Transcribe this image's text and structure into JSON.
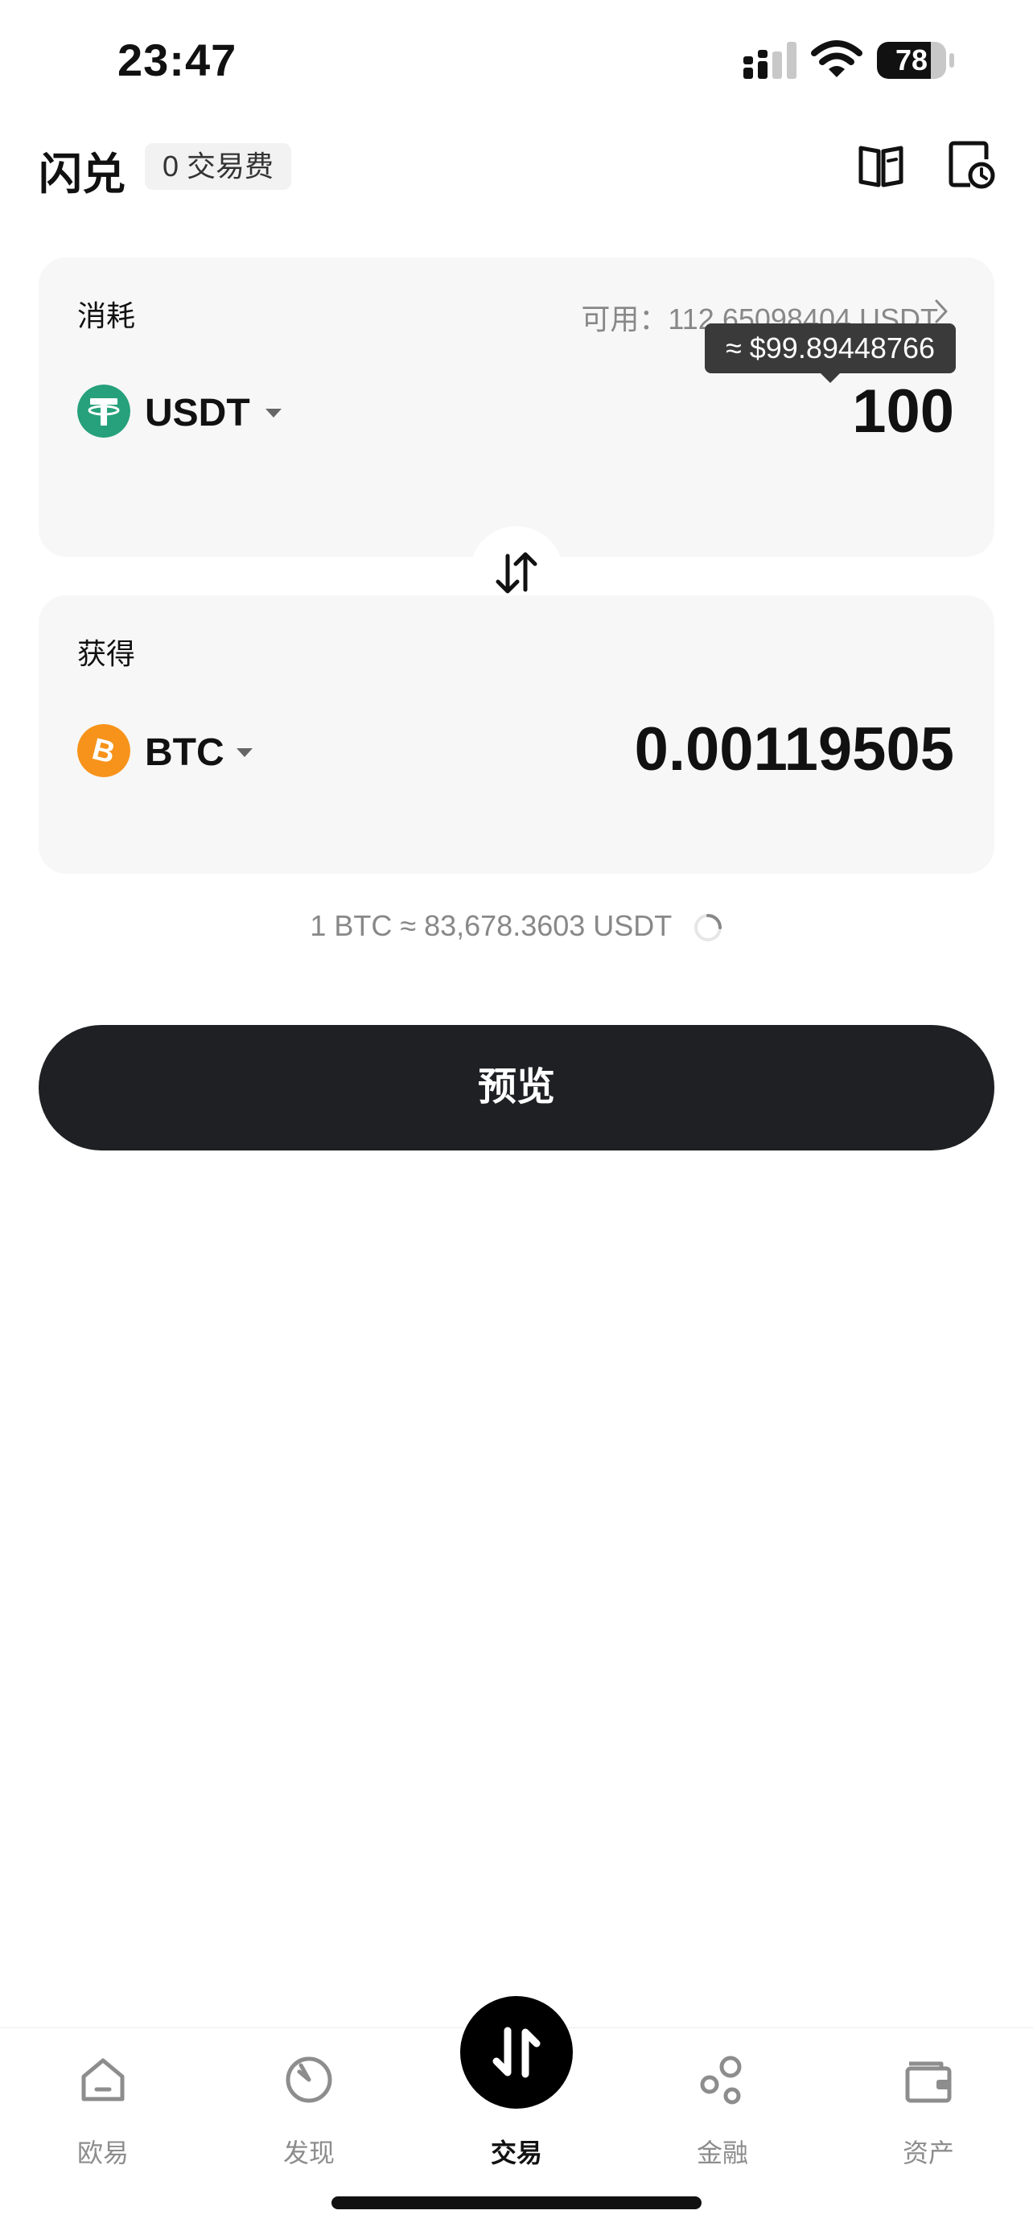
{
  "status_bar": {
    "time": "23:47",
    "battery_level": "78",
    "battery_fraction": 0.78
  },
  "header": {
    "title": "闪兑",
    "fee_badge": "0 交易费"
  },
  "consume": {
    "label": "消耗",
    "available": "可用：112.65098404 USDT",
    "tooltip": "≈ $99.89448766",
    "coin": "USDT",
    "amount": "100",
    "coin_color": "#26a17b"
  },
  "receive": {
    "label": "获得",
    "coin": "BTC",
    "amount": "0.00119505",
    "coin_color": "#f7931a"
  },
  "rate_text": "1 BTC ≈ 83,678.3603 USDT",
  "preview_button": "预览",
  "nav": {
    "items": [
      {
        "label": "欧易",
        "icon": "home-icon"
      },
      {
        "label": "发现",
        "icon": "discover-icon"
      },
      {
        "label": "交易",
        "icon": "trade-icon"
      },
      {
        "label": "金融",
        "icon": "finance-icon"
      },
      {
        "label": "资产",
        "icon": "wallet-icon"
      }
    ]
  }
}
